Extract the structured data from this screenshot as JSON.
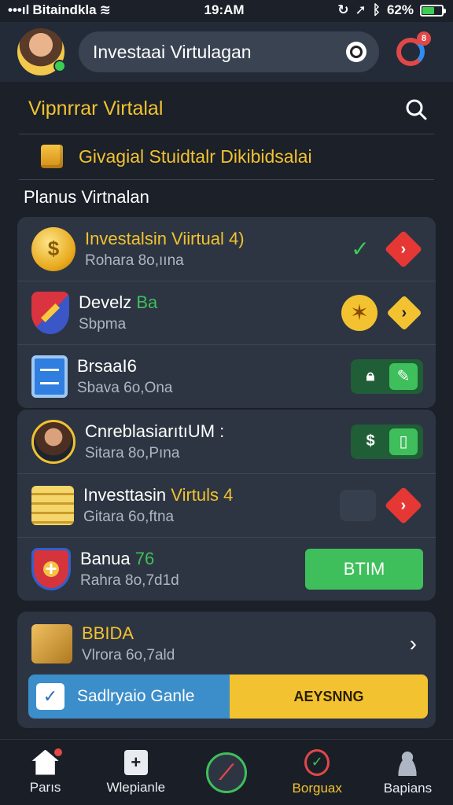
{
  "status_bar": {
    "carrier": "Bitaindkla",
    "time": "19:AM",
    "battery": "62%",
    "battery_level": 0.62
  },
  "header": {
    "search_text": "Investaai Virtulagan",
    "notification_count": "8"
  },
  "section": {
    "title": "Vipnrrar Virtalal",
    "promo_text": "Givagial Stuidtalr Dikibidsalai",
    "plans_label": "Planus Virtnalan"
  },
  "card1": [
    {
      "title": "Investalsin Viirtual 4)",
      "subtitle": "Rohara 8o,ıına",
      "icon": "coin-icon"
    },
    {
      "title": "Develz",
      "title_accent": "Ba",
      "subtitle": "Sbpma",
      "icon": "shield-icon"
    },
    {
      "title": "BrsaaI6",
      "subtitle": "Sbava 6o,Ona",
      "icon": "document-icon"
    }
  ],
  "card2": [
    {
      "title": "CnreblasiarıtıUM :",
      "subtitle": "Sitara 8o,Pına",
      "icon": "person-icon"
    },
    {
      "title": "Investtasin",
      "title_accent": "Virtuls 4",
      "subtitle": "Gitara 6o,ftna",
      "icon": "stack-icon"
    },
    {
      "title": "Banua",
      "title_accent": "76",
      "subtitle": "Rahra 8o,7d1d",
      "icon": "shield-plus-icon",
      "button": "BTIM"
    }
  ],
  "card3": {
    "title": "BBIDA",
    "subtitle": "Vlrora 6o,7ald"
  },
  "split_bar": {
    "left_label": "Sadlryaio Ganle",
    "right_label": "AEYSNNG"
  },
  "nav": [
    {
      "label": "Parıs",
      "icon": "home-icon"
    },
    {
      "label": "Wlepianle",
      "icon": "bag-icon"
    },
    {
      "label": "",
      "icon": "compass-icon"
    },
    {
      "label": "Borguax",
      "icon": "shield-check-icon"
    },
    {
      "label": "Bapians",
      "icon": "person-icon"
    }
  ],
  "colors": {
    "accent_yellow": "#f2c230",
    "accent_green": "#3fbf5b",
    "accent_red": "#e53835",
    "background": "#1b2029",
    "card": "#2d3542"
  }
}
